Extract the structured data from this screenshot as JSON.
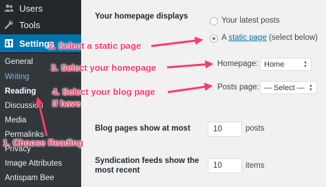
{
  "sidebar": {
    "menu": [
      {
        "label": "Users",
        "icon": "users-icon"
      },
      {
        "label": "Tools",
        "icon": "wrench-icon"
      },
      {
        "label": "Settings",
        "icon": "settings-icon"
      }
    ],
    "submenu": [
      "General",
      "Writing",
      "Reading",
      "Discussion",
      "Media",
      "Permalinks",
      "Privacy",
      "Image Attributes",
      "Antispam Bee"
    ],
    "current_submenu": "Reading"
  },
  "settings": {
    "homepage_displays_label": "Your homepage displays",
    "latest_posts_label": "Your latest posts",
    "static_page_prefix": "A ",
    "static_page_link": "static page",
    "static_page_suffix": " (select below)",
    "homepage_label": "Homepage:",
    "homepage_value": "Home",
    "posts_page_label": "Posts page:",
    "posts_page_value": "— Select —",
    "blog_pages_label": "Blog pages show at most",
    "blog_pages_value": "10",
    "blog_pages_unit": "posts",
    "syndication_label_line1": "Syndication feeds show the",
    "syndication_label_line2": "most recent",
    "syndication_value": "10",
    "syndication_unit": "items"
  },
  "annotations": {
    "step1": "1. Choose Reading",
    "step2": "2. Select a static page",
    "step3": "3. Select your homepage",
    "step4_line1": "4. Select your blog page",
    "step4_line2": "if have"
  },
  "colors": {
    "sidebar_bg": "#23282d",
    "submenu_bg": "#32373c",
    "active_blue": "#0073aa",
    "annotation_pink": "#ff3b6a"
  }
}
